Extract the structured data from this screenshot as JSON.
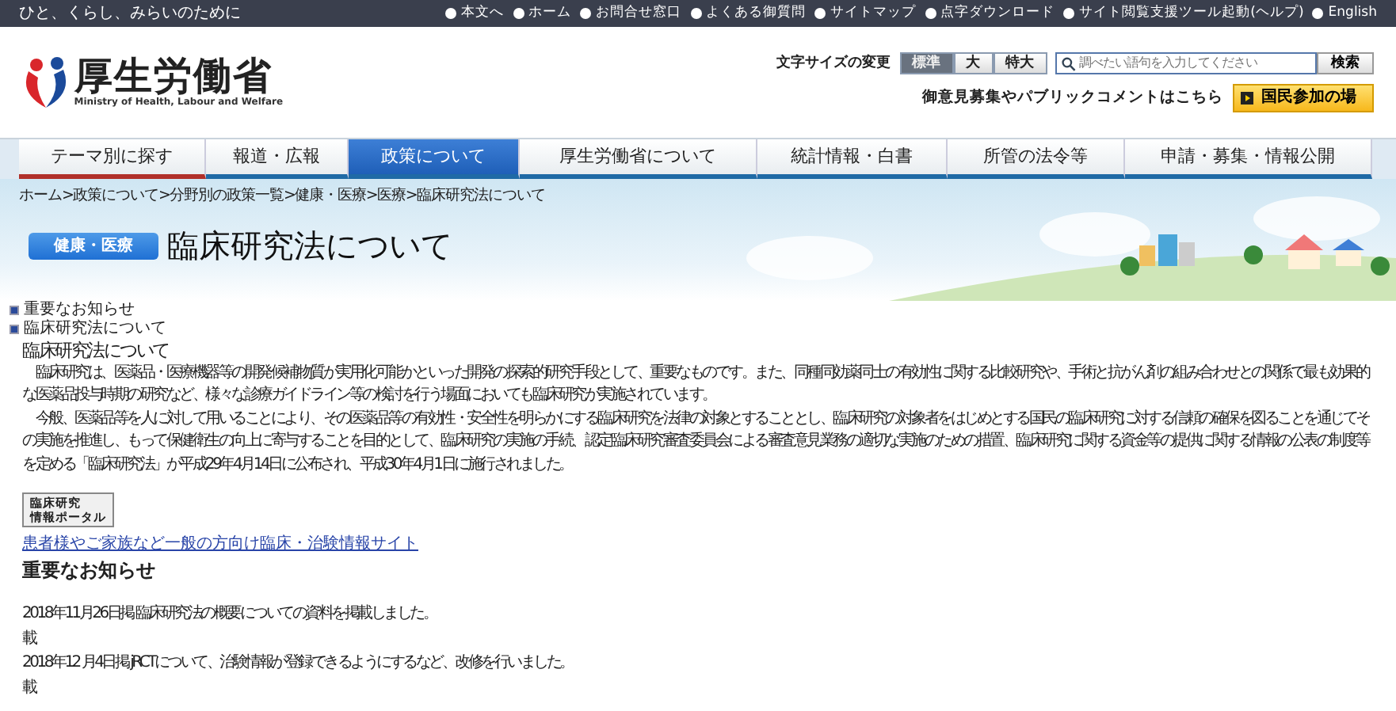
{
  "top_bar": {
    "tagline": "ひと、くらし、みらいのために",
    "links": [
      "本文へ",
      "ホーム",
      "お問合せ窓口",
      "よくある御質問",
      "サイトマップ",
      "点字ダウンロード",
      "サイト閲覧支援ツール起動(ヘルプ)",
      "English"
    ]
  },
  "logo": {
    "name": "厚生労働省",
    "subtitle": "Ministry of Health, Labour and Welfare"
  },
  "font_size": {
    "label": "文字サイズの変更",
    "options": [
      {
        "label": "標準",
        "selected": true
      },
      {
        "label": "大",
        "selected": false
      },
      {
        "label": "特大",
        "selected": false
      }
    ]
  },
  "search": {
    "placeholder": "調べたい語句を入力してください",
    "button": "検索"
  },
  "participation": {
    "text": "御意見募集やパブリックコメントはこちら",
    "button": "国民参加の場"
  },
  "nav": [
    {
      "label": "テーマ別に探す",
      "selected": false
    },
    {
      "label": "報道・広報",
      "selected": false
    },
    {
      "label": "政策について",
      "selected": true
    },
    {
      "label": "厚生労働省について",
      "selected": false
    },
    {
      "label": "統計情報・白書",
      "selected": false
    },
    {
      "label": "所管の法令等",
      "selected": false
    },
    {
      "label": "申請・募集・情報公開",
      "selected": false
    }
  ],
  "breadcrumb": {
    "separator": ">",
    "links": [
      "ホーム",
      "政策について",
      "分野別の政策一覧",
      "健康・医療",
      "医療"
    ],
    "current": "臨床研究法について"
  },
  "category_tag": "健康・医療",
  "page_title": "臨床研究法について",
  "toc": [
    "重要なお知らせ",
    "臨床研究法について"
  ],
  "section_heading": "臨床研究法について",
  "paragraphs": [
    "　臨床研究は、医薬品・医療機器等の開発候補物質が実用化可能かといった開発の探索的研究手段として、重要なものです。また、同種同効薬同士の有効性に関する比較研究や、手術と抗がん剤の組み合わせとの関係で最も効果的な医薬品投与時期の研究など、様々な診療ガイドライン等の検討を行う場面においても臨床研究が実施されています。",
    "　今般、医薬品等を人に対して用いることにより、その医薬品等の有効性・安全性を明らかにする臨床研究を法律の対象とすることとし、臨床研究の対象者をはじめとする国民の臨床研究に対する信頼の確保を図ることを通じてその実施を推進し、もって保健衛生の向上に寄与することを目的として、臨床研究の実施の手続、認定臨床研究審査委員会による審査意見業務の適切な実施のための措置、臨床研究に関する資金等の提供に関する情報の公表の制度等を定める「臨床研究法」が平成29年4月14日に公布され、平成30年4月1日に施行されました。"
  ],
  "portal": {
    "lines": [
      "臨床研究",
      "情報ポータル"
    ],
    "link": "患者様やご家族など一般の方向け臨床・治験情報サイト"
  },
  "notices_heading": "重要なお知らせ",
  "notices": [
    {
      "text": "2018年11月26日掲  臨床研究法の概要についての資料を掲載しました。",
      "mark": "載"
    },
    {
      "text": "2018年12 月4日掲  jRCTについて、治験情報が登録できるようにするなど、改修を行いました。",
      "mark": "載"
    }
  ]
}
